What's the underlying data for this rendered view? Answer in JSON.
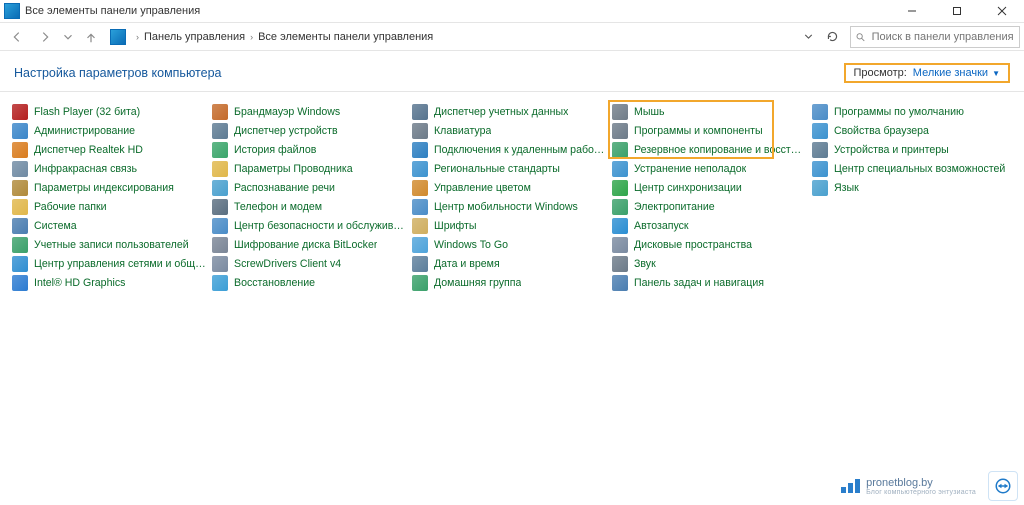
{
  "window": {
    "title": "Все элементы панели управления"
  },
  "address": {
    "root": "Панель управления",
    "current": "Все элементы панели управления"
  },
  "search": {
    "placeholder": "Поиск в панели управления"
  },
  "header": {
    "title": "Настройка параметров компьютера",
    "view_label": "Просмотр:",
    "view_value": "Мелкие значки"
  },
  "items": [
    {
      "label": "Flash Player (32 бита)",
      "icon": "#b41f1f"
    },
    {
      "label": "Администрирование",
      "icon": "#3b86c9"
    },
    {
      "label": "Диспетчер Realtek HD",
      "icon": "#d97c1f"
    },
    {
      "label": "Инфракрасная связь",
      "icon": "#6f8aa3"
    },
    {
      "label": "Параметры индексирования",
      "icon": "#b08a3a"
    },
    {
      "label": "Рабочие папки",
      "icon": "#e0b74a"
    },
    {
      "label": "Система",
      "icon": "#4a7db0"
    },
    {
      "label": "Учетные записи пользователей",
      "icon": "#3aa06a"
    },
    {
      "label": "Центр управления сетями и общи...",
      "icon": "#2f8ed1"
    },
    {
      "label": "Intel® HD Graphics",
      "icon": "#2c7bd1"
    },
    {
      "label": "Брандмауэр Windows",
      "icon": "#c46a2a"
    },
    {
      "label": "Диспетчер устройств",
      "icon": "#5e7b93"
    },
    {
      "label": "История файлов",
      "icon": "#3aa56a"
    },
    {
      "label": "Параметры Проводника",
      "icon": "#e0b74a"
    },
    {
      "label": "Распознавание речи",
      "icon": "#4aa0ce"
    },
    {
      "label": "Телефон и модем",
      "icon": "#5a6e80"
    },
    {
      "label": "Центр безопасности и обслужива...",
      "icon": "#4a8cc7"
    },
    {
      "label": "Шифрование диска BitLocker",
      "icon": "#7a8596"
    },
    {
      "label": "ScrewDrivers Client v4",
      "icon": "#7a8aa0"
    },
    {
      "label": "Восстановление",
      "icon": "#3b9ed6"
    },
    {
      "label": "Диспетчер учетных данных",
      "icon": "#56738e"
    },
    {
      "label": "Клавиатура",
      "icon": "#6c7a88"
    },
    {
      "label": "Подключения к удаленным рабоч...",
      "icon": "#2d7fc1"
    },
    {
      "label": "Региональные стандарты",
      "icon": "#3c92cf"
    },
    {
      "label": "Управление цветом",
      "icon": "#d18a2d"
    },
    {
      "label": "Центр мобильности Windows",
      "icon": "#4a8cc7"
    },
    {
      "label": "Шрифты",
      "icon": "#cfae5f"
    },
    {
      "label": "Windows To Go",
      "icon": "#4ea3da"
    },
    {
      "label": "Дата и время",
      "icon": "#5c7e9b"
    },
    {
      "label": "Домашняя группа",
      "icon": "#3aa06a"
    },
    {
      "label": "Мышь",
      "icon": "#707c88"
    },
    {
      "label": "Программы и компоненты",
      "icon": "#6c7a88"
    },
    {
      "label": "Резервное копирование и восстан...",
      "icon": "#3aa06a"
    },
    {
      "label": "Устранение неполадок",
      "icon": "#3c92cf"
    },
    {
      "label": "Центр синхронизации",
      "icon": "#2fa54a"
    },
    {
      "label": "Электропитание",
      "icon": "#3aa06a"
    },
    {
      "label": "Автозапуск",
      "icon": "#2b8ed2"
    },
    {
      "label": "Дисковые пространства",
      "icon": "#7a8aa0"
    },
    {
      "label": "Звук",
      "icon": "#6c7a88"
    },
    {
      "label": "Панель задач и навигация",
      "icon": "#4a7db0"
    },
    {
      "label": "Программы по умолчанию",
      "icon": "#4a8cc7"
    },
    {
      "label": "Свойства браузера",
      "icon": "#3c92cf"
    },
    {
      "label": "Устройства и принтеры",
      "icon": "#5e7b93"
    },
    {
      "label": "Центр специальных возможностей",
      "icon": "#3c92cf"
    },
    {
      "label": "Язык",
      "icon": "#4aa0ce"
    }
  ],
  "watermark": {
    "site": "pronetblog.by",
    "tagline": "Блог компьютерного энтузиаста"
  }
}
